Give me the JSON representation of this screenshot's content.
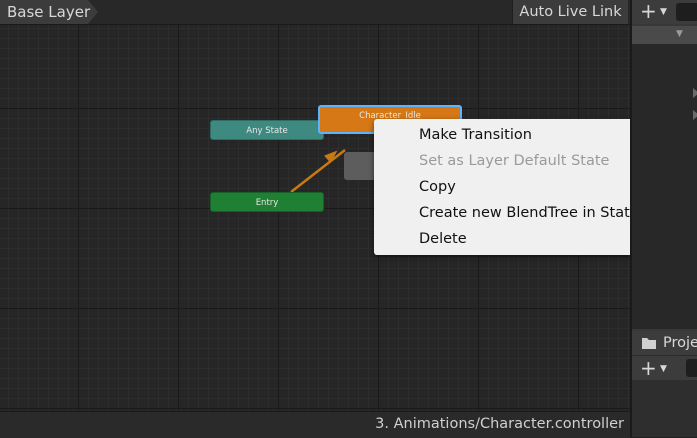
{
  "toolbar": {
    "breadcrumb": "Base Layer",
    "auto_live_link": "Auto Live Link"
  },
  "graph": {
    "states": {
      "any_state": "Any State",
      "entry": "Entry",
      "character_idle": "Character_Idle"
    },
    "colors": {
      "any_state": "#3f8a80",
      "entry": "#1f7f33",
      "default_state": "#d57815",
      "selection": "#5ab4ff",
      "transition": "#c87a12"
    }
  },
  "context_menu": {
    "items": [
      {
        "label": "Make Transition",
        "enabled": true
      },
      {
        "label": "Set as Layer Default State",
        "enabled": false
      },
      {
        "label": "Copy",
        "enabled": true
      },
      {
        "label": "Create new BlendTree in State",
        "enabled": true
      },
      {
        "label": "Delete",
        "enabled": true
      }
    ]
  },
  "status_bar": {
    "path": "3. Animations/Character.controller"
  },
  "right_panel": {
    "project_tab": "Proje",
    "plus": "+",
    "caret": "▼"
  }
}
